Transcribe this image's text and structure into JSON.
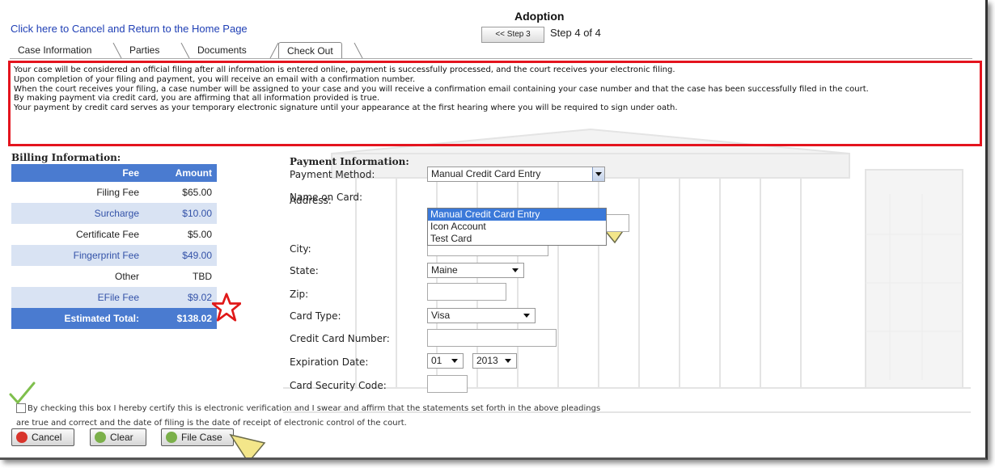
{
  "header": {
    "cancel_link": "Click here to Cancel and Return to the Home Page",
    "title": "Adoption",
    "step_back_label": "<< Step 3",
    "step_text": "Step 4 of 4"
  },
  "tabs": [
    {
      "label": "Case Information"
    },
    {
      "label": "Parties"
    },
    {
      "label": "Documents"
    },
    {
      "label": "Check Out",
      "active": true
    }
  ],
  "notice": {
    "lines": [
      "Your case will be considered an official filing after all information is entered online, payment is successfully processed, and the court receives your electronic filing.",
      "Upon completion of your filing and payment, you will receive an email with a confirmation number.",
      "When the court receives your filing, a case number will be assigned to your case and you will receive a confirmation email containing your case number and that the case has been successfully filed in the court.",
      "By making payment via credit card, you are affirming that all information provided is true.",
      "Your payment by credit card serves as your temporary electronic signature until your appearance at the first hearing where you will be required to sign under oath."
    ]
  },
  "billing": {
    "title": "Billing Information:",
    "headers": {
      "fee": "Fee",
      "amount": "Amount"
    },
    "rows": [
      {
        "fee": "Filing Fee",
        "amount": "$65.00"
      },
      {
        "fee": "Surcharge",
        "amount": "$10.00"
      },
      {
        "fee": "Certificate Fee",
        "amount": "$5.00"
      },
      {
        "fee": "Fingerprint Fee",
        "amount": "$49.00"
      },
      {
        "fee": "Other",
        "amount": "TBD"
      },
      {
        "fee": "EFile Fee",
        "amount": "$9.02"
      }
    ],
    "total": {
      "label": "Estimated Total:",
      "amount": "$138.02"
    }
  },
  "payment": {
    "title": "Payment Information:",
    "labels": {
      "method": "Payment Method:",
      "name": "Name on Card:",
      "address": "Address:",
      "city": "City:",
      "state": "State:",
      "zip": "Zip:",
      "card_type": "Card Type:",
      "card_number": "Credit Card Number:",
      "expiration": "Expiration Date:",
      "security": "Card Security Code:"
    },
    "method_value": "Manual Credit Card Entry",
    "method_options": [
      "Manual Credit Card Entry",
      "Icon Account",
      "Test Card"
    ],
    "state_value": "Maine",
    "card_type_value": "Visa",
    "exp_month": "01",
    "exp_year": "2013"
  },
  "certification": {
    "text_line1": "By checking this box I hereby certify this is electronic verification and I swear and affirm that the statements set forth in the above pleadings",
    "text_line2": "are true and correct and the date of filing is the date of receipt of electronic control of the court."
  },
  "buttons": {
    "cancel": "Cancel",
    "clear": "Clear",
    "file_case": "File Case"
  },
  "colors": {
    "header_blue": "#4a7bd0",
    "alt_row": "#d9e3f3",
    "notice_border": "#e4141e",
    "link": "#1f3fb5",
    "pointer_yellow": "#f3e68a"
  }
}
